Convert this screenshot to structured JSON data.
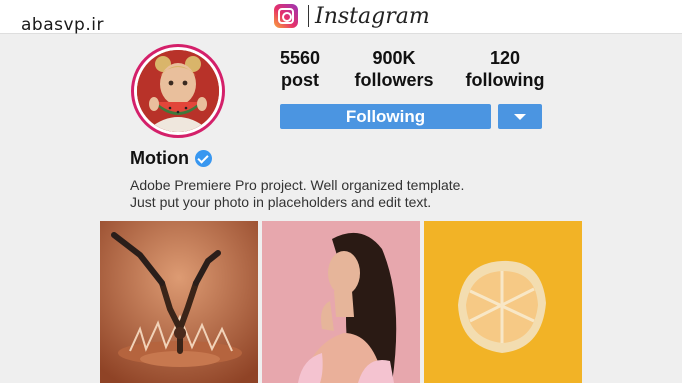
{
  "watermark": "abasvp.ir",
  "brand": {
    "name": "Instagram"
  },
  "profile": {
    "name": "Motion",
    "bio": [
      "Adobe Premiere Pro project. Well organized template.",
      "Just put your photo in placeholders and edit text."
    ]
  },
  "stats": [
    {
      "value": "5560",
      "label": "post"
    },
    {
      "value": "900K",
      "label": "followers"
    },
    {
      "value": "120",
      "label": "following"
    }
  ],
  "actions": {
    "follow_label": "Following"
  },
  "grid": [
    {
      "name": "dancer-photo"
    },
    {
      "name": "woman-portrait-photo"
    },
    {
      "name": "grapefruit-photo"
    }
  ],
  "colors": {
    "accent": "#4b95e1",
    "verified": "#3897f0",
    "avatar_ring": "#d4206a",
    "background": "#efefef"
  }
}
